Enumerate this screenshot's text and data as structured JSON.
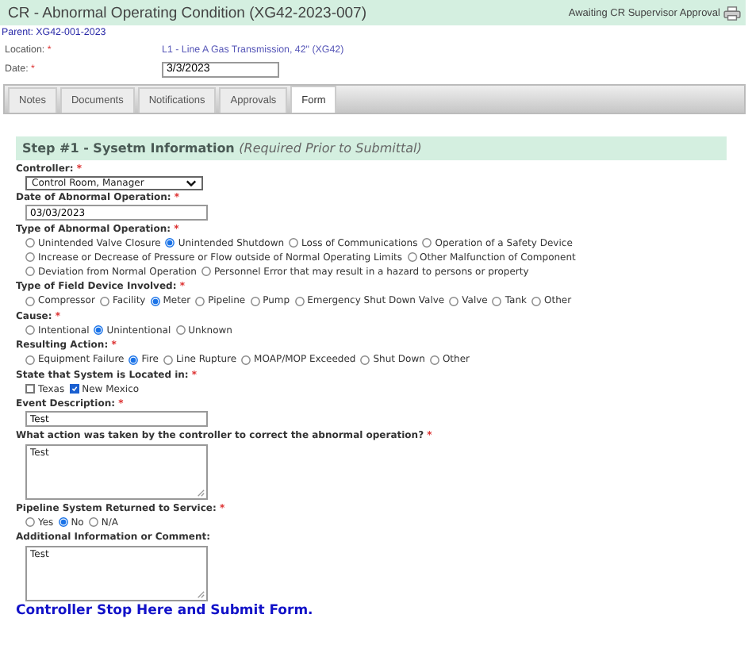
{
  "header": {
    "title": "CR - Abnormal Operating Condition (XG42-2023-007)",
    "status": "Awaiting CR Supervisor Approval"
  },
  "parent": "Parent: XG42-001-2023",
  "fields": [
    {
      "kind": "link",
      "label": "Location:",
      "mark": "*",
      "value": "L1 - Line A Gas Transmission, 42\" (XG42)"
    },
    {
      "kind": "input",
      "label": "Date:",
      "mark": "*",
      "value": "3/3/2023"
    }
  ],
  "tabs": [
    {
      "label": "Notes",
      "selected": false
    },
    {
      "label": "Documents",
      "selected": false
    },
    {
      "label": "Notifications",
      "selected": false
    },
    {
      "label": "Approvals",
      "selected": false
    },
    {
      "label": "Form",
      "selected": true
    }
  ],
  "section": {
    "title": "Step #1 - Sysetm Information",
    "note": "(Required Prior to Submittal)"
  },
  "questions": [
    {
      "kind": "select",
      "label": "Controller:",
      "mark": "*",
      "value": "Control Room, Manager"
    },
    {
      "kind": "text",
      "label": "Date of Abnormal Operation:",
      "mark": "*",
      "value": "03/03/2023"
    },
    {
      "kind": "radio",
      "label": "Type of Abnormal Operation:",
      "mark": "*",
      "options": [
        {
          "label": "Unintended Valve Closure",
          "selected": false
        },
        {
          "label": "Unintended Shutdown",
          "selected": true
        },
        {
          "label": "Loss of Communications",
          "selected": false
        },
        {
          "label": "Operation of a Safety Device",
          "selected": false
        },
        {
          "label": "Increase or Decrease of Pressure or Flow outside of Normal Operating Limits",
          "selected": false
        },
        {
          "label": "Other Malfunction of Component",
          "selected": false
        },
        {
          "label": "Deviation from Normal Operation",
          "selected": false
        },
        {
          "label": "Personnel Error that may result in a hazard to persons or property",
          "selected": false
        }
      ]
    },
    {
      "kind": "radio",
      "label": "Type of Field Device Involved:",
      "mark": "*",
      "options": [
        {
          "label": "Compressor",
          "selected": false
        },
        {
          "label": "Facility",
          "selected": false
        },
        {
          "label": "Meter",
          "selected": true
        },
        {
          "label": "Pipeline",
          "selected": false
        },
        {
          "label": "Pump",
          "selected": false
        },
        {
          "label": "Emergency Shut Down Valve",
          "selected": false
        },
        {
          "label": "Valve",
          "selected": false
        },
        {
          "label": "Tank",
          "selected": false
        },
        {
          "label": "Other",
          "selected": false
        }
      ]
    },
    {
      "kind": "radio",
      "label": "Cause:",
      "mark": "*",
      "options": [
        {
          "label": "Intentional",
          "selected": false
        },
        {
          "label": "Unintentional",
          "selected": true
        },
        {
          "label": "Unknown",
          "selected": false
        }
      ]
    },
    {
      "kind": "radio",
      "label": "Resulting Action:",
      "mark": "*",
      "options": [
        {
          "label": "Equipment Failure",
          "selected": false
        },
        {
          "label": "Fire",
          "selected": true
        },
        {
          "label": "Line Rupture",
          "selected": false
        },
        {
          "label": "MOAP/MOP Exceeded",
          "selected": false
        },
        {
          "label": "Shut Down",
          "selected": false
        },
        {
          "label": "Other",
          "selected": false
        }
      ]
    },
    {
      "kind": "checkbox",
      "label": "State that System is Located in:",
      "mark": "*",
      "options": [
        {
          "label": "Texas",
          "checked": false
        },
        {
          "label": "New Mexico",
          "checked": true
        }
      ]
    },
    {
      "kind": "text",
      "label": "Event Description:",
      "mark": "*",
      "value": "Test"
    },
    {
      "kind": "textarea",
      "label": "What action was taken by the controller to correct the abnormal operation?",
      "mark": "*",
      "value": "Test"
    },
    {
      "kind": "radio",
      "label": "Pipeline System Returned to Service:",
      "mark": "*",
      "options": [
        {
          "label": "Yes",
          "selected": false
        },
        {
          "label": "No",
          "selected": true
        },
        {
          "label": "N/A",
          "selected": false
        }
      ]
    },
    {
      "kind": "textarea",
      "label": "Additional Information or Comment:",
      "value": "Test"
    }
  ],
  "submit_note": "Controller Stop Here and Submit Form."
}
